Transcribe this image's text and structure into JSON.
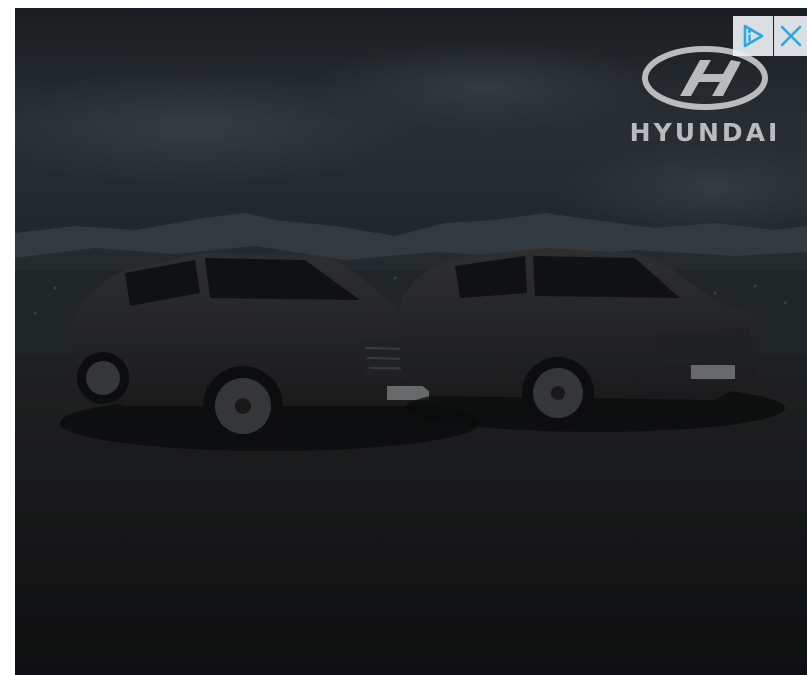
{
  "ad": {
    "brand_name": "HYUNDAI",
    "adchoices_icon": "adchoices-icon",
    "close_icon": "close-icon",
    "colors": {
      "accent": "#2aa8e0",
      "logo": "#b9bbbd",
      "sky": "#2b343b",
      "ground": "#1a1b1c"
    }
  }
}
